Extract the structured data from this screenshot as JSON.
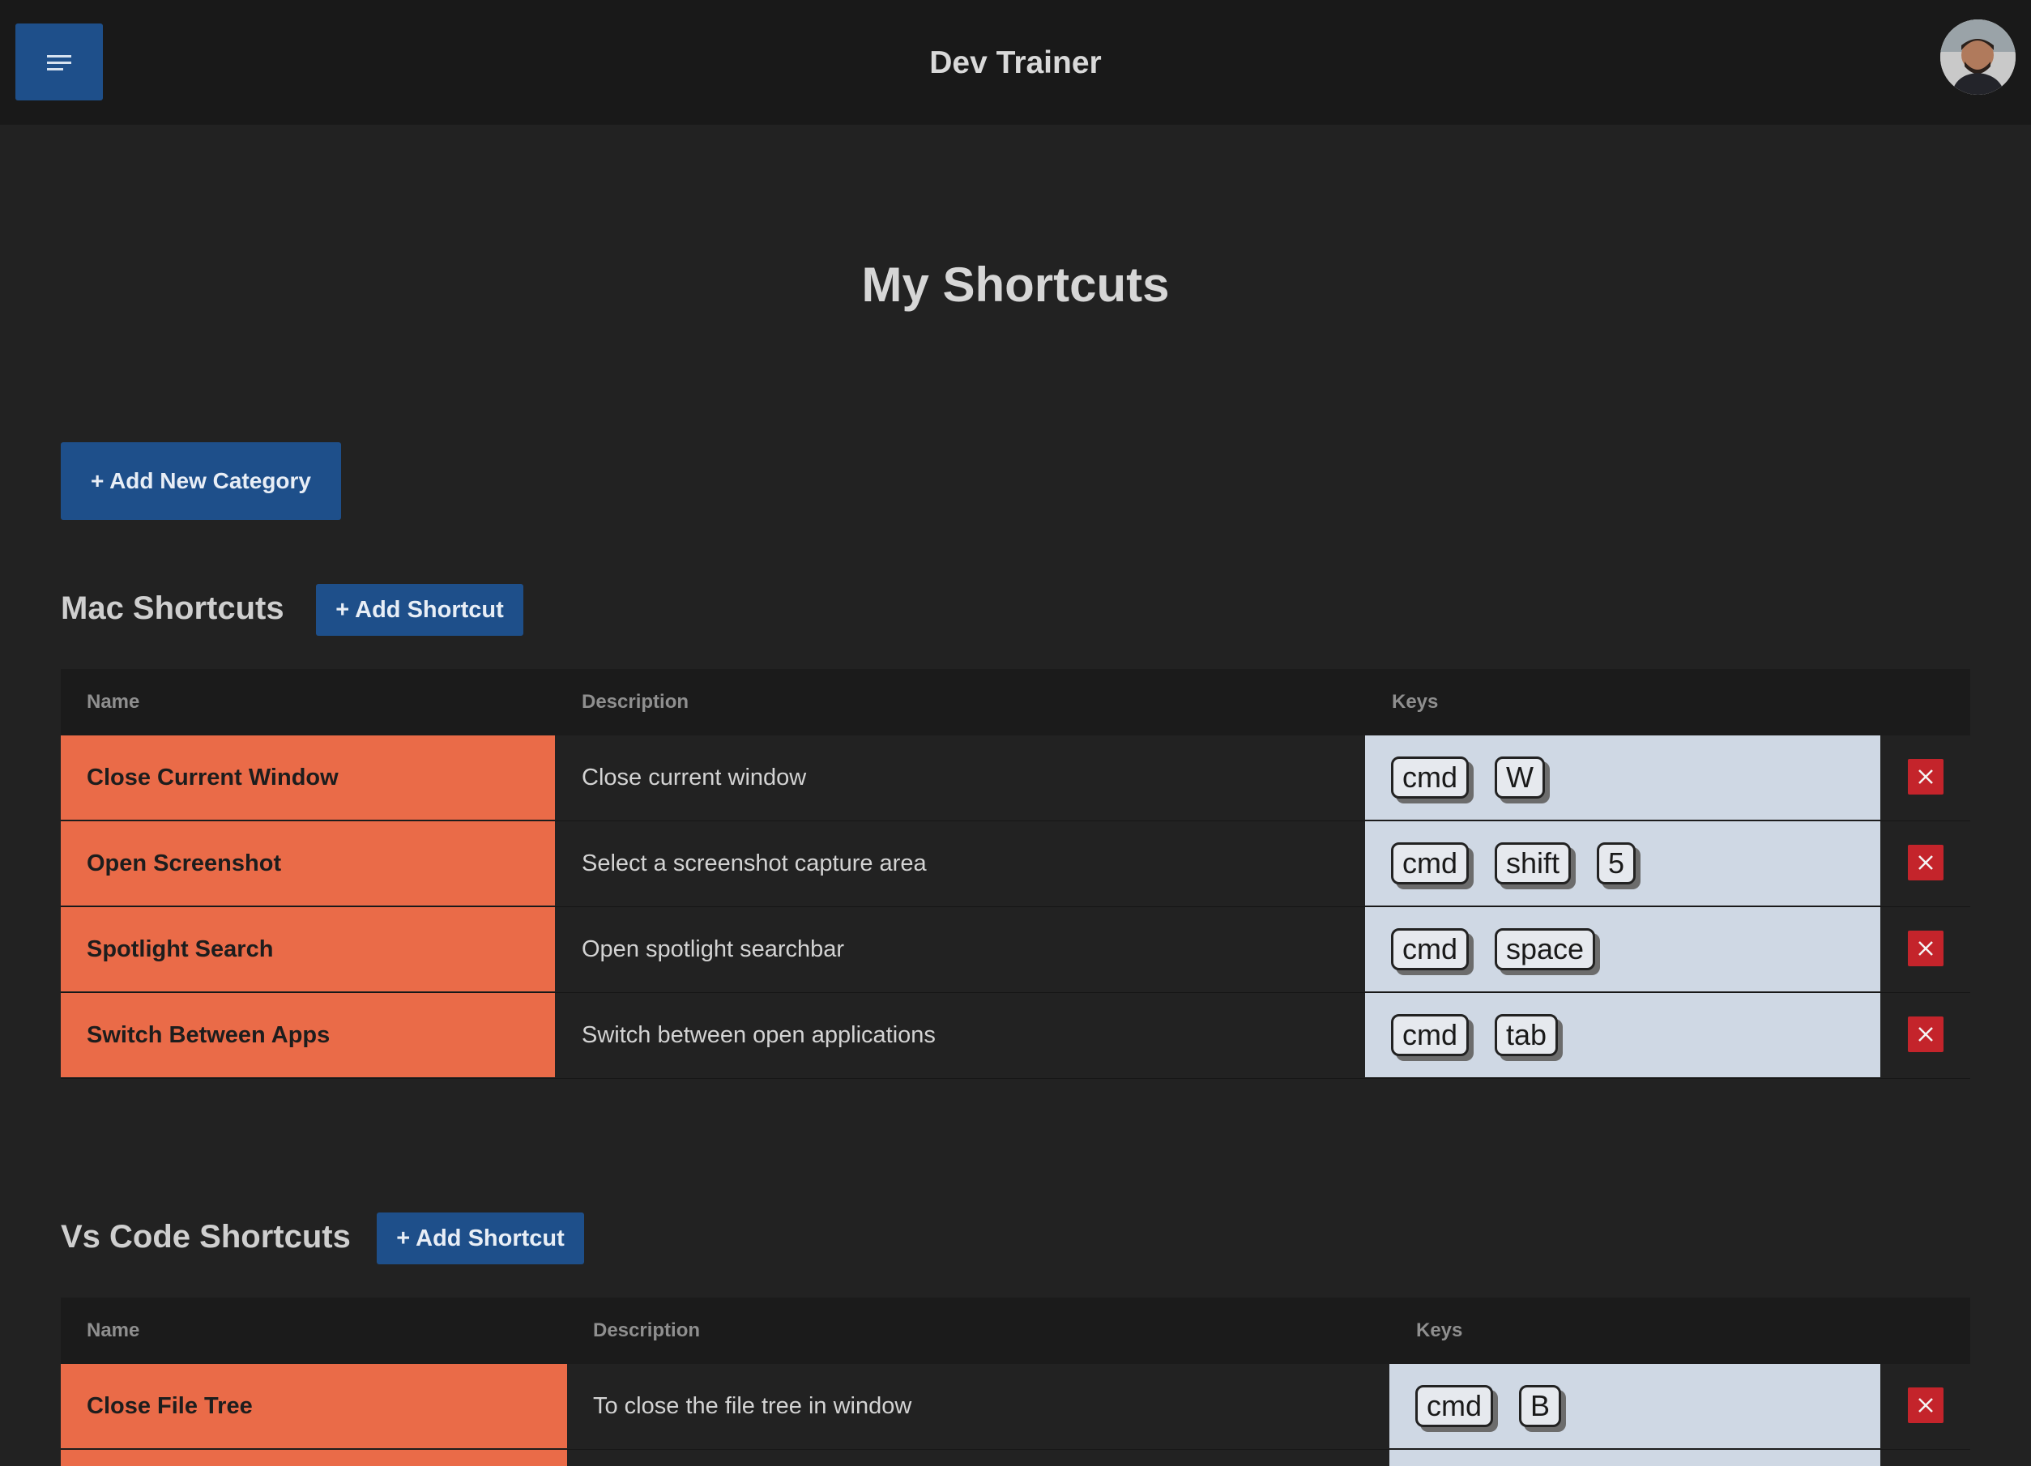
{
  "header": {
    "app_title": "Dev Trainer",
    "menu_icon": "menu-lines-icon",
    "avatar_icon": "user-avatar"
  },
  "page": {
    "title": "My Shortcuts",
    "add_category_label": "+ Add New Category"
  },
  "categories": [
    {
      "title": "Mac Shortcuts",
      "add_label": "+ Add Shortcut",
      "columns": {
        "name": "Name",
        "description": "Description",
        "keys": "Keys"
      },
      "rows": [
        {
          "name": "Close Current Window",
          "description": "Close current window",
          "keys": [
            "cmd",
            "W"
          ]
        },
        {
          "name": "Open Screenshot",
          "description": "Select a screenshot capture area",
          "keys": [
            "cmd",
            "shift",
            "5"
          ]
        },
        {
          "name": "Spotlight Search",
          "description": "Open spotlight searchbar",
          "keys": [
            "cmd",
            "space"
          ]
        },
        {
          "name": "Switch Between Apps",
          "description": "Switch between open applications",
          "keys": [
            "cmd",
            "tab"
          ]
        }
      ]
    },
    {
      "title": "Vs Code Shortcuts",
      "add_label": "+ Add Shortcut",
      "columns": {
        "name": "Name",
        "description": "Description",
        "keys": "Keys"
      },
      "rows": [
        {
          "name": "Close File Tree",
          "description": "To close the file tree in window",
          "keys": [
            "cmd",
            "B"
          ]
        }
      ]
    }
  ],
  "colors": {
    "background": "#222222",
    "topbar": "#191919",
    "primary_button": "#1e4f8a",
    "name_cell": "#ea6b48",
    "keys_cell": "#cfd8e4",
    "delete_button": "#c4242b"
  }
}
